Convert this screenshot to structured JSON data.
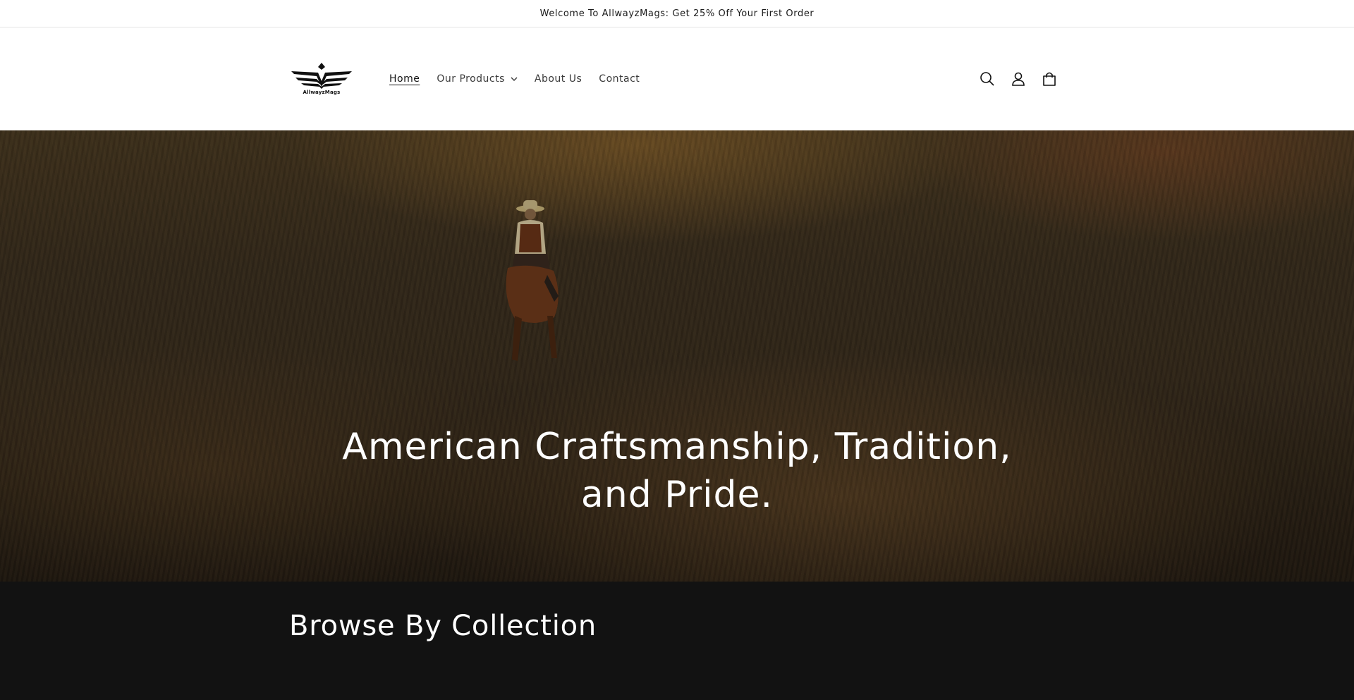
{
  "announcement": {
    "text": "Welcome To AllwayzMags: Get 25% Off Your First Order"
  },
  "header": {
    "logo_text": "AllwayzMags",
    "nav": [
      {
        "label": "Home",
        "active": true
      },
      {
        "label": "Our Products",
        "has_dropdown": true
      },
      {
        "label": "About Us"
      },
      {
        "label": "Contact"
      }
    ],
    "icons": [
      "search-icon",
      "account-icon",
      "cart-icon"
    ]
  },
  "hero": {
    "heading": "American Craftsmanship, Tradition, and Pride."
  },
  "collections": {
    "title": "Browse By Collection"
  },
  "colors": {
    "header_bg": "#ffffff",
    "section_bg": "#121212",
    "text_dark": "#121212",
    "text_light": "#ffffff"
  }
}
